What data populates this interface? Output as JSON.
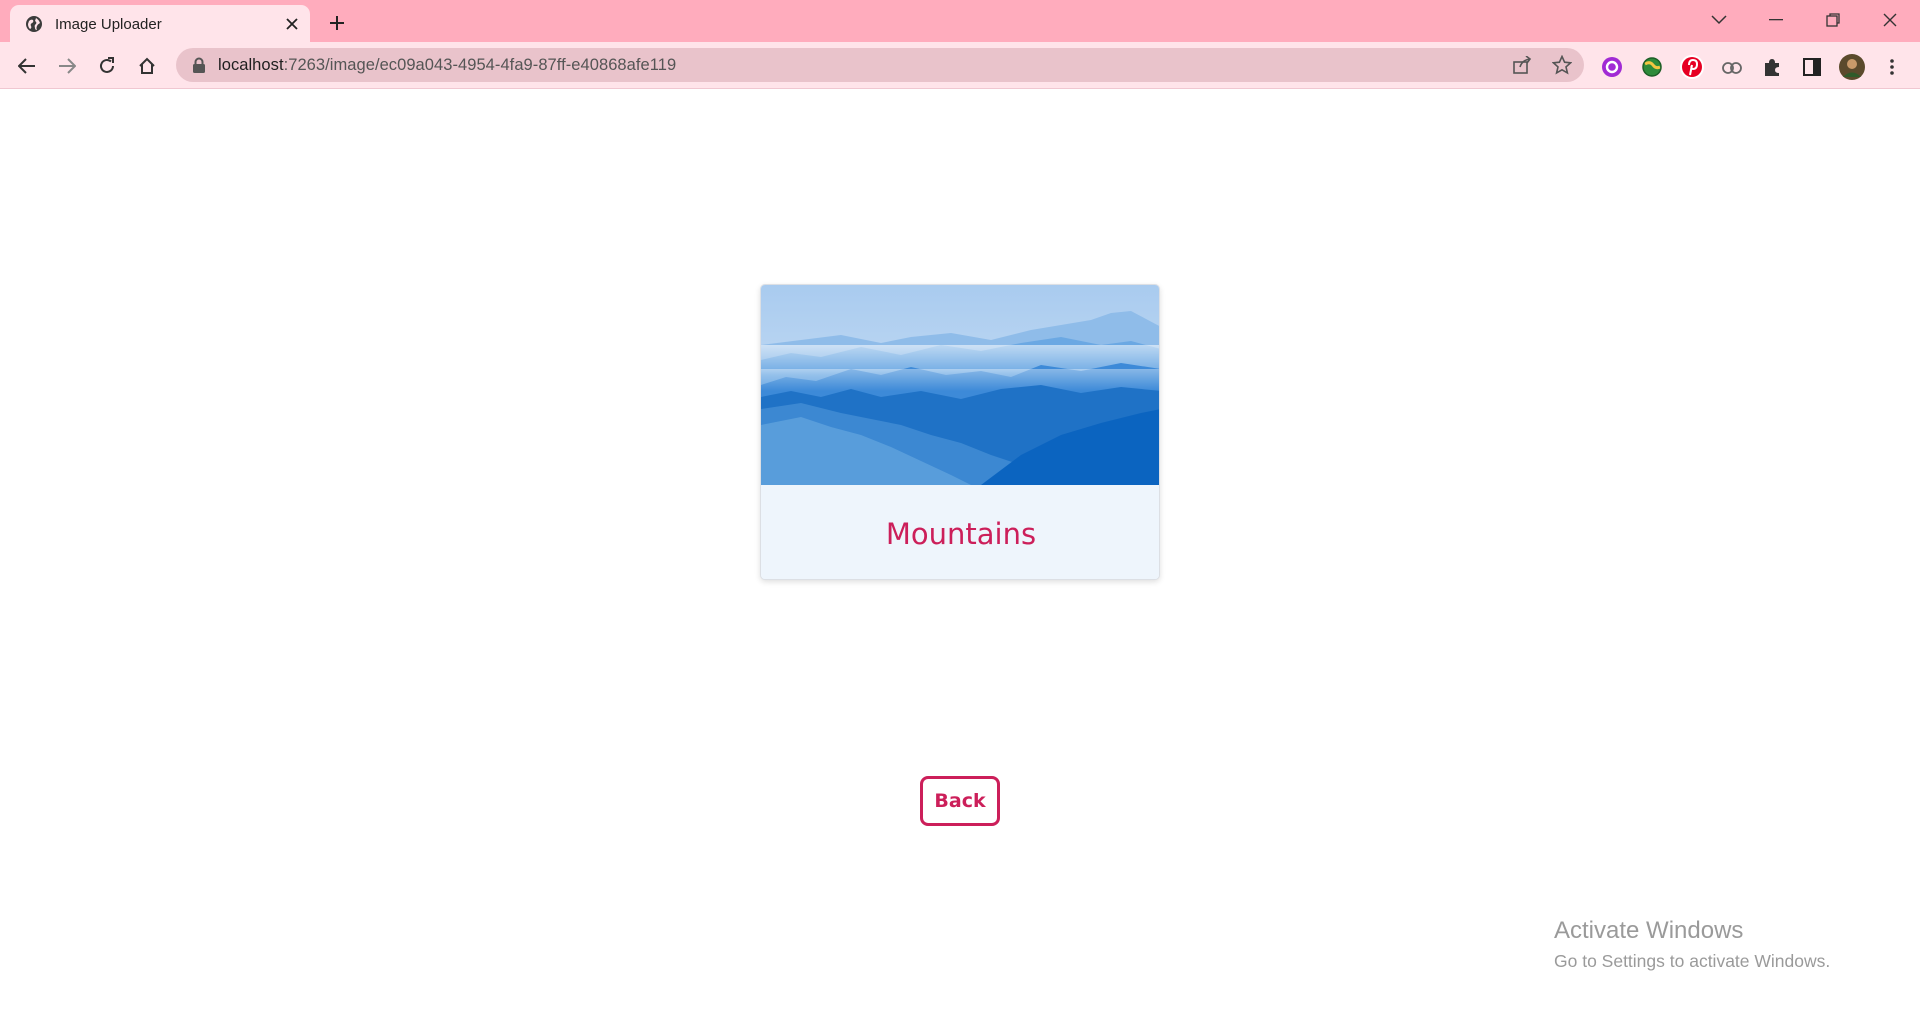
{
  "browser": {
    "tab": {
      "title": "Image Uploader",
      "favicon": "globe-icon"
    },
    "address": {
      "host": "localhost",
      "path": ":7263/image/ec09a043-4954-4fa9-87ff-e40868afe119"
    },
    "chrome_color": "#ffacbd",
    "toolbar_color": "#ffe4ea"
  },
  "card": {
    "image": "mountains-landscape",
    "title": "Mountains"
  },
  "actions": {
    "back_label": "Back"
  },
  "accent_color": "#cc1f5a",
  "watermark": {
    "title": "Activate Windows",
    "subtitle": "Go to Settings to activate Windows."
  }
}
